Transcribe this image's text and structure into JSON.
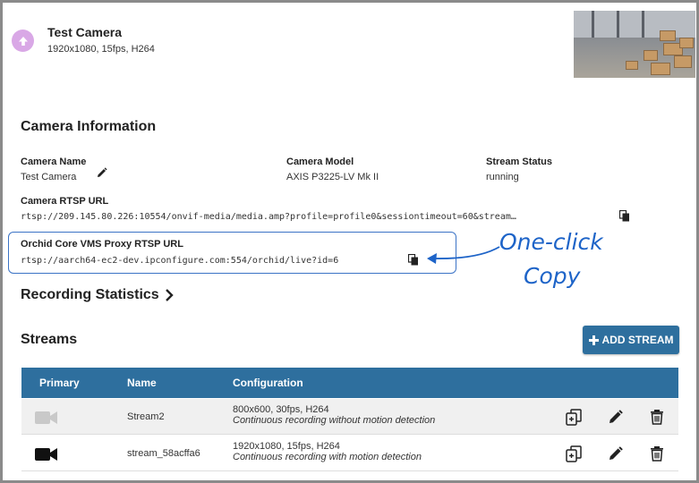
{
  "camera": {
    "title": "Test Camera",
    "subtitle": "1920x1080, 15fps, H264"
  },
  "info": {
    "heading": "Camera Information",
    "name_label": "Camera Name",
    "name_value": "Test Camera",
    "model_label": "Camera Model",
    "model_value": "AXIS P3225-LV Mk II",
    "status_label": "Stream Status",
    "status_value": "running",
    "rtsp_label": "Camera RTSP URL",
    "rtsp_value": "rtsp://209.145.80.226:10554/onvif-media/media.amp?profile=profile0&sessiontimeout=60&stream…",
    "proxy_label": "Orchid Core VMS Proxy RTSP URL",
    "proxy_value": "rtsp://aarch64-ec2-dev.ipconfigure.com:554/orchid/live?id=6"
  },
  "callout": {
    "line1": "One-click",
    "line2": "Copy",
    "color": "#1e64c8"
  },
  "recording": {
    "heading": "Recording Statistics"
  },
  "streams": {
    "heading": "Streams",
    "add_label": "ADD STREAM",
    "columns": [
      "Primary",
      "Name",
      "Configuration"
    ],
    "rows": [
      {
        "primary": false,
        "name": "Stream2",
        "config": "800x600, 30fps, H264",
        "mode": "Continuous recording without motion detection"
      },
      {
        "primary": true,
        "name": "stream_58acffa6",
        "config": "1920x1080, 15fps, H264",
        "mode": "Continuous recording with motion detection"
      }
    ]
  },
  "colors": {
    "accent": "#2e6f9e",
    "camera_icon": "#d9a8e6",
    "box_border": "#3b73c6"
  },
  "icons": {
    "camera_status": "arrow-up-icon",
    "edit": "pencil-icon",
    "copy": "copy-icon",
    "duplicate": "duplicate-icon",
    "delete": "trash-icon",
    "video": "video-camera-icon"
  }
}
